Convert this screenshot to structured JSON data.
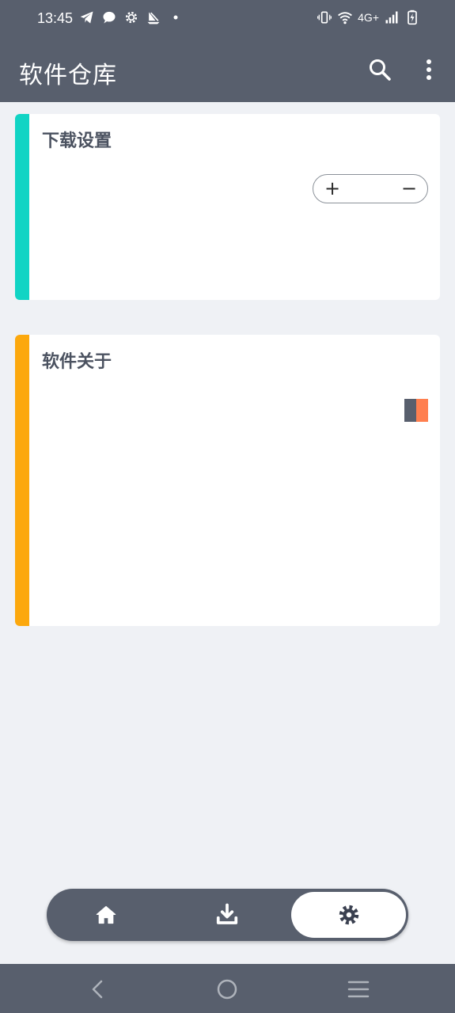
{
  "status_bar": {
    "time": "13:45",
    "left_icons": [
      "telegram-icon",
      "chat-bubble-icon",
      "gear-icon",
      "sail-icon",
      "dot-icon"
    ],
    "right_icons": [
      "vibrate-icon",
      "wifi-icon",
      "signal-icon",
      "battery-charging-icon"
    ],
    "network": "4G+"
  },
  "app_bar": {
    "title": "软件仓库",
    "actions": [
      "search-icon",
      "more-vert-icon"
    ]
  },
  "cards": [
    {
      "title": "下载设置",
      "accent_color": "#11d4c4",
      "stepper": {
        "plus_label": "+",
        "minus_label": "−"
      }
    },
    {
      "title": "软件关于",
      "accent_color": "#fca80d",
      "theme_swatch": {
        "colors": [
          "#585f6d",
          "#ff7f4f"
        ]
      }
    }
  ],
  "bottom_nav": {
    "items": [
      {
        "icon": "home-icon",
        "selected": false
      },
      {
        "icon": "download-icon",
        "selected": false
      },
      {
        "icon": "settings-icon",
        "selected": true
      }
    ]
  },
  "system_nav": [
    "back-icon",
    "home-circle-icon",
    "menu-icon"
  ],
  "colors": {
    "primary": "#585f6d",
    "background": "#eff1f5",
    "surface": "#ffffff"
  }
}
